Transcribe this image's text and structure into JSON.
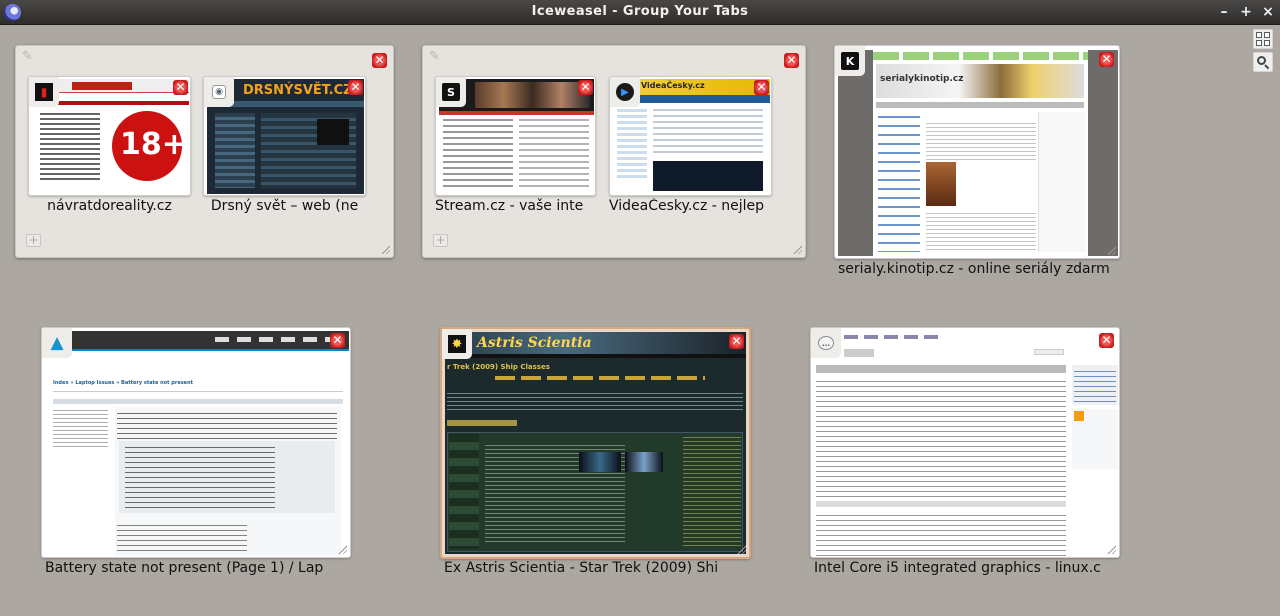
{
  "window": {
    "title": "Iceweasel - Group Your Tabs"
  },
  "window_controls": {
    "minimize": "–",
    "maximize": "+",
    "close": "×"
  },
  "toolbar": {
    "group_view_icon": "tab-groups-icon",
    "search_icon": "search-icon"
  },
  "groups": [
    {
      "tabs": [
        {
          "title": "návratdoreality.cz",
          "favicon": "nr-favicon",
          "thumb_text": "18+"
        },
        {
          "title": "Drsný svět – web (ne",
          "favicon": "globe-favicon",
          "thumb_text": "DRSNÝSVĚT.CZ"
        }
      ]
    },
    {
      "tabs": [
        {
          "title": "Stream.cz - vaše inte",
          "favicon": "stream-favicon"
        },
        {
          "title": "VideaČesky.cz - nejlep",
          "favicon": "play-favicon",
          "thumb_text": "VideaČesky.cz"
        }
      ]
    }
  ],
  "tabs": [
    {
      "title": "serialy.kinotip.cz - online seriály zdarm",
      "favicon": "kinotip-favicon",
      "thumb_text": "serialykinotip.cz"
    },
    {
      "title": "Battery state not present (Page 1) / Lap",
      "favicon": "arch-favicon",
      "thumb_heading": "Index » Laptop Issues » Battery state not present"
    },
    {
      "title": "Ex Astris Scientia - Star Trek (2009) Shi",
      "favicon": "star-favicon",
      "thumb_text": "Astris Scientia",
      "thumb_heading": "r Trek (2009) Ship Classes"
    },
    {
      "title": "Intel Core i5 integrated graphics - linux.c",
      "favicon": "chat-favicon"
    }
  ],
  "colors": {
    "background": "#aca7a1",
    "group_bg": "#e6e3df",
    "close": "#d22a2a",
    "titlebar": "#3b3937"
  }
}
